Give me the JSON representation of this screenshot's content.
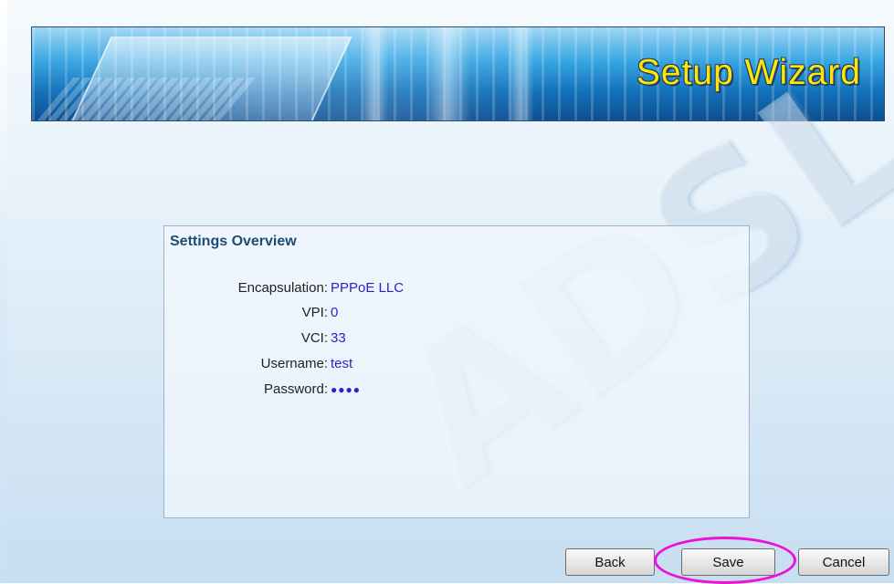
{
  "banner": {
    "title": "Setup Wizard"
  },
  "watermark": "ADSL",
  "panel": {
    "title": "Settings Overview",
    "rows": [
      {
        "label": "Encapsulation:",
        "value": "PPPoE LLC"
      },
      {
        "label": "VPI:",
        "value": "0"
      },
      {
        "label": "VCI:",
        "value": "33"
      },
      {
        "label": "Username:",
        "value": "test"
      },
      {
        "label": "Password:",
        "value": "●●●●"
      }
    ]
  },
  "buttons": {
    "back": "Back",
    "save": "Save",
    "cancel": "Cancel"
  },
  "colors": {
    "value_text": "#2626c8",
    "banner_title": "#ffe500",
    "highlight": "#ee10d8"
  }
}
